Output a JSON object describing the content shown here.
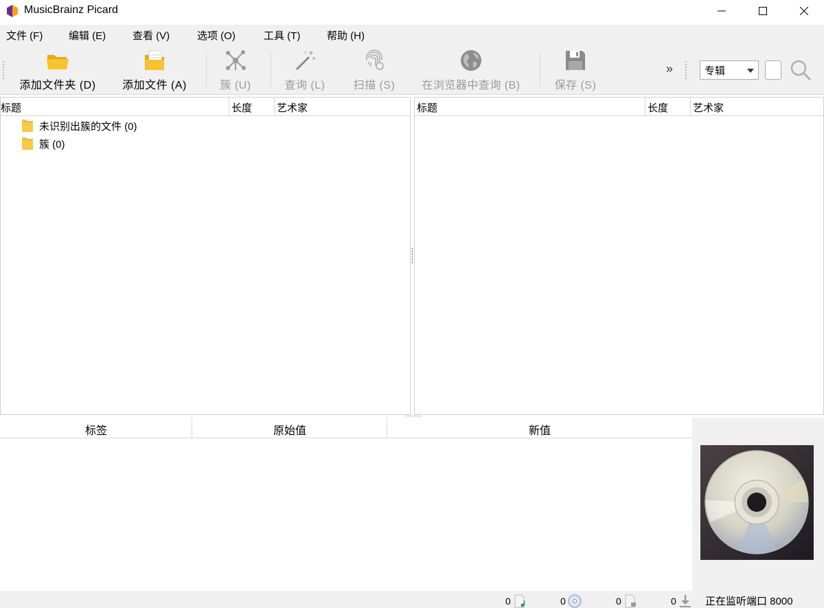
{
  "window": {
    "title": "MusicBrainz Picard",
    "colors": {
      "accent_orange": "#f7a01d",
      "accent_purple": "#6a2c91",
      "folder": "#f7c948"
    }
  },
  "menu": {
    "items": [
      {
        "label": "文件 (F)"
      },
      {
        "label": "编辑 (E)"
      },
      {
        "label": "查看 (V)"
      },
      {
        "label": "选项 (O)"
      },
      {
        "label": "工具 (T)"
      },
      {
        "label": "帮助 (H)"
      }
    ]
  },
  "toolbar": {
    "add_folder": "添加文件夹 (D)",
    "add_files": "添加文件 (A)",
    "cluster": "簇 (U)",
    "lookup": "查询 (L)",
    "scan": "扫描 (S)",
    "browser_lookup": "在浏览器中查询 (B)",
    "save": "保存 (S)",
    "overflow": "»",
    "search_type": "专辑",
    "search_value": ""
  },
  "left_panel": {
    "columns": [
      "标题",
      "长度",
      "艺术家"
    ],
    "rows": [
      {
        "label": "未识别出簇的文件 (0)",
        "icon": "folder-icon"
      },
      {
        "label": "簇 (0)",
        "icon": "folder-icon"
      }
    ]
  },
  "right_panel": {
    "columns": [
      "标题",
      "长度",
      "艺术家"
    ]
  },
  "metadata": {
    "columns": [
      "标签",
      "原始值",
      "新值"
    ]
  },
  "status": {
    "files": "0",
    "albums": "0",
    "pending": "0",
    "downloads": "0",
    "listening": "正在监听端口 8000"
  }
}
